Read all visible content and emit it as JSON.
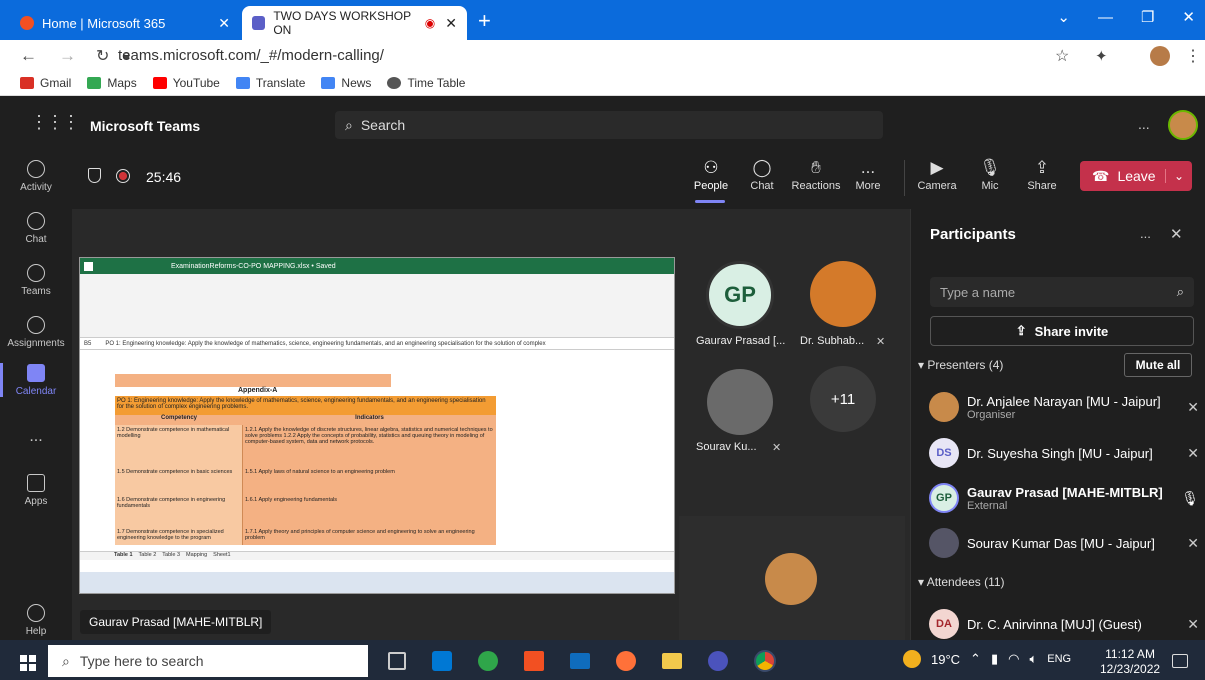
{
  "browser": {
    "tabs": [
      {
        "title": "Home | Microsoft 365"
      },
      {
        "title": "TWO DAYS WORKSHOP ON"
      }
    ],
    "url": "teams.microsoft.com/_#/modern-calling/",
    "bookmarks": [
      {
        "label": "Gmail",
        "color": "#d93025"
      },
      {
        "label": "Maps",
        "color": "#34a853"
      },
      {
        "label": "YouTube",
        "color": "#ff0000"
      },
      {
        "label": "Translate",
        "color": "#4285f4"
      },
      {
        "label": "News",
        "color": "#4285f4"
      },
      {
        "label": "Time Table",
        "color": "#555555"
      }
    ]
  },
  "teams": {
    "app_name": "Microsoft Teams",
    "search_placeholder": "Search",
    "rail": [
      {
        "label": "Activity",
        "icon": "bell-icon"
      },
      {
        "label": "Chat",
        "icon": "chat-icon"
      },
      {
        "label": "Teams",
        "icon": "teams-icon"
      },
      {
        "label": "Assignments",
        "icon": "assignments-icon"
      },
      {
        "label": "Calendar",
        "icon": "calendar-icon"
      },
      {
        "label": "Apps",
        "icon": "apps-icon"
      },
      {
        "label": "Help",
        "icon": "help-icon"
      }
    ],
    "more": "...",
    "timer": "25:46",
    "controls": [
      "People",
      "Chat",
      "Reactions",
      "More",
      "Camera",
      "Mic",
      "Share"
    ],
    "leave": "Leave",
    "accent": "#c4314b"
  },
  "shared_sheet": {
    "filename": "ExaminationReforms-CO-PO MAPPING.xlsx • Saved",
    "cell_ref": "B5",
    "formula": "PO 1: Engineering knowledge: Apply the knowledge of mathematics, science, engineering fundamentals, and an engineering specialisation for the solution of complex",
    "appendix": "Appendix-A",
    "po_text": "PO 1: Engineering knowledge: Apply the knowledge of mathematics, science, engineering fundamentals, and an engineering specialisation for the solution of complex engineering problems.",
    "headers": [
      "Competency",
      "Indicators"
    ],
    "rows": [
      {
        "competency": "1.2 Demonstrate competence in mathematical modelling",
        "indicators": "1.2.1 Apply the knowledge of discrete structures, linear algebra, statistics and numerical techniques to solve problems 1.2.2 Apply the concepts of probability, statistics and queuing theory in modeling of computer-based system, data and network protocols."
      },
      {
        "competency": "1.5 Demonstrate competence in basic sciences",
        "indicators": "1.5.1 Apply laws of natural science to an engineering problem"
      },
      {
        "competency": "1.6 Demonstrate competence in engineering fundamentals",
        "indicators": "1.6.1 Apply engineering fundamentals"
      },
      {
        "competency": "1.7 Demonstrate competence in specialized engineering knowledge to the program",
        "indicators": "1.7.1 Apply theory and principles of computer science and engineering to solve an engineering problem"
      }
    ],
    "sheets": [
      "Table 1",
      "Table 2",
      "Table 3",
      "Mapping",
      "Sheet1"
    ]
  },
  "tiles": [
    {
      "initials": "GP",
      "name": "Gaurav Prasad [..."
    },
    {
      "name": "Dr. Subhab..."
    },
    {
      "name": "Sourav Ku..."
    },
    {
      "overflow": "+11"
    }
  ],
  "presenter_label": "Gaurav Prasad [MAHE-MITBLR]",
  "participants": {
    "title": "Participants",
    "search_placeholder": "Type a name",
    "share_invite": "Share invite",
    "presenters_label": "Presenters (4)",
    "mute_all": "Mute all",
    "presenters": [
      {
        "initials": "",
        "name": "Dr. Anjalee Narayan [MU - Jaipur]",
        "sub": "Organiser",
        "color": "#c88a4a"
      },
      {
        "initials": "DS",
        "name": "Dr. Suyesha Singh [MU - Jaipur]",
        "sub": "",
        "color": "#e8e6f5"
      },
      {
        "initials": "GP",
        "name": "Gaurav Prasad [MAHE-MITBLR]",
        "sub": "External",
        "color": "#d9efe4"
      },
      {
        "initials": "",
        "name": "Sourav Kumar Das [MU - Jaipur]",
        "sub": "",
        "color": "#556"
      }
    ],
    "attendees_label": "Attendees (11)",
    "attendees": [
      {
        "initials": "DA",
        "name": "Dr. C. Anirvinna [MUJ] (Guest)",
        "color": "#f3d6d1"
      }
    ]
  },
  "taskbar": {
    "search": "Type here to search",
    "weather": "19°C",
    "lang": "ENG",
    "time": "11:12 AM",
    "date": "12/23/2022"
  }
}
